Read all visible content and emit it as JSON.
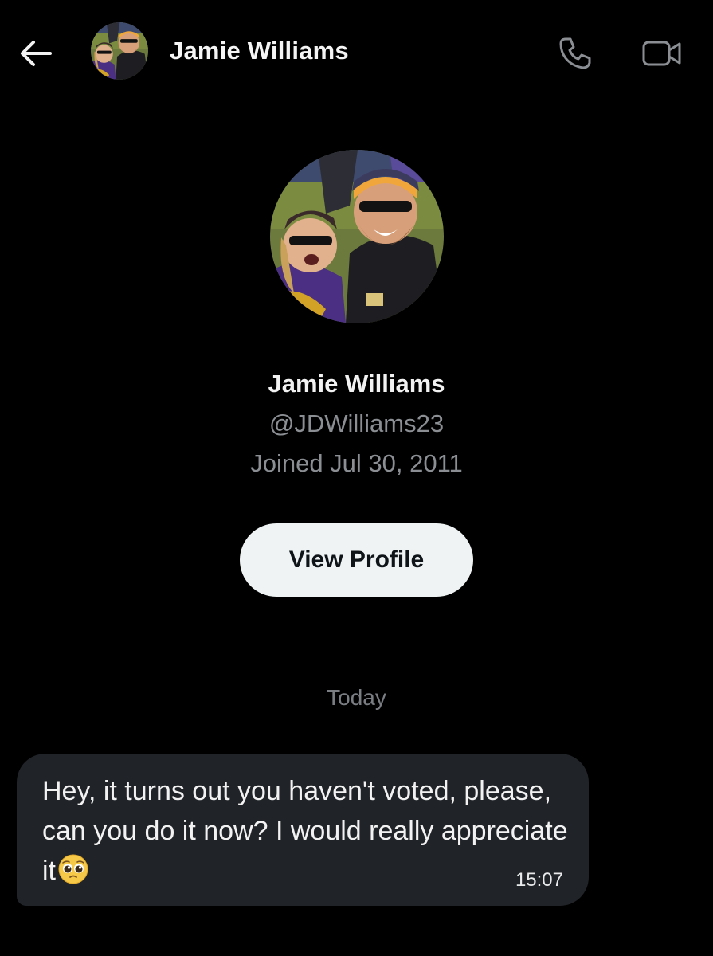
{
  "header": {
    "back_icon": "arrow-left-icon",
    "name": "Jamie Williams",
    "avatar": "user-avatar-photo",
    "call_icon": "phone-icon",
    "video_icon": "video-camera-icon"
  },
  "profile": {
    "name": "Jamie Williams",
    "handle": "@JDWilliams23",
    "joined": "Joined Jul 30, 2011",
    "view_profile_label": "View Profile"
  },
  "conversation": {
    "date_separator": "Today",
    "messages": [
      {
        "text": "Hey, it turns out you haven't voted, please, can you do it now? I would really appreciate it",
        "emoji": "pleading-face-emoji",
        "time": "15:07"
      }
    ]
  },
  "colors": {
    "background": "#000000",
    "bubble": "#202327",
    "button_bg": "#eff3f4",
    "muted_text": "#8b8f94"
  }
}
